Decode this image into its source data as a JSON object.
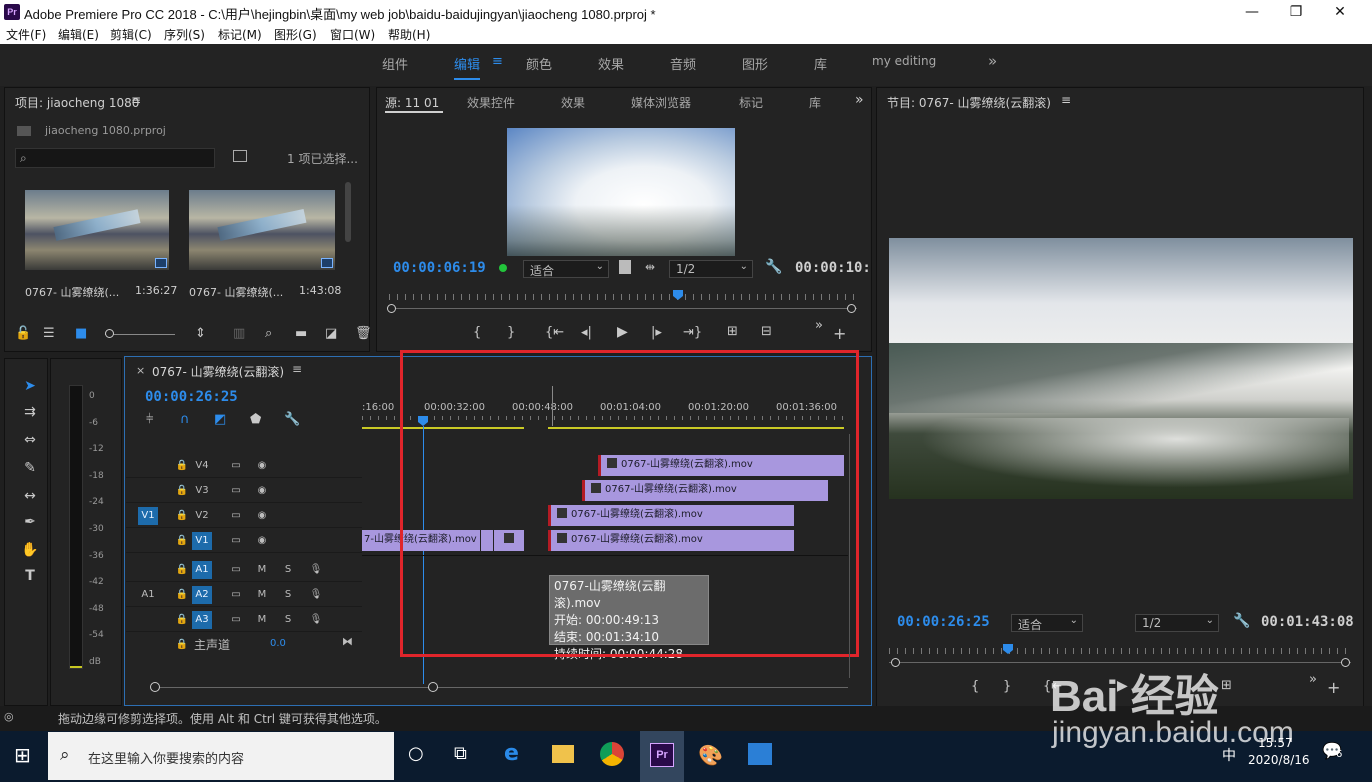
{
  "window": {
    "title": "Adobe Premiere Pro CC 2018 - C:\\用户\\hejingbin\\桌面\\my web job\\baidu-baidujingyan\\jiaocheng 1080.prproj *",
    "logo_text": "Pr",
    "minimize": "—",
    "maximize": "❐",
    "close": "✕"
  },
  "menu": [
    "文件(F)",
    "编辑(E)",
    "剪辑(C)",
    "序列(S)",
    "标记(M)",
    "图形(G)",
    "窗口(W)",
    "帮助(H)"
  ],
  "workspaces": {
    "tabs": [
      "组件",
      "编辑",
      "颜色",
      "效果",
      "音频",
      "图形",
      "库",
      "my editing"
    ],
    "active": "编辑",
    "more": "»"
  },
  "project": {
    "title": "项目: jiaocheng 1080",
    "file": "jiaocheng 1080.prproj",
    "search_placeholder": "",
    "selection": "1 项已选择...",
    "items": [
      {
        "name": "0767- 山雾缭绕(...",
        "duration": "1:36:27"
      },
      {
        "name": "0767- 山雾缭绕(...",
        "duration": "1:43:08"
      }
    ]
  },
  "source": {
    "tabs": [
      "源: 11 01",
      "效果控件",
      "效果",
      "媒体浏览器",
      "标记",
      "库"
    ],
    "timecode": "00:00:06:19",
    "fit": "适合",
    "resolution": "1/2",
    "duration": "00:00:10:"
  },
  "program": {
    "title": "节目: 0767- 山雾缭绕(云翻滚)",
    "timecode": "00:00:26:25",
    "fit": "适合",
    "resolution": "1/2",
    "duration": "00:01:43:08"
  },
  "timeline": {
    "sequence": "0767- 山雾缭绕(云翻滚)",
    "timecode": "00:00:26:25",
    "ruler": [
      ":16:00",
      "00:00:32:00",
      "00:00:48:00",
      "00:01:04:00",
      "00:01:20:00",
      "00:01:36:00"
    ],
    "video_tracks": [
      "V4",
      "V3",
      "V2",
      "V1"
    ],
    "audio_tracks": [
      "A1",
      "A2",
      "A3"
    ],
    "source_v": "V1",
    "source_a": "A1",
    "master": "主声道",
    "master_value": "0.0",
    "clip_name": "0767-山雾缭绕(云翻滚).mov",
    "clip_name_left": "7-山雾缭绕(云翻滚).mov",
    "mute": "M",
    "solo": "S",
    "tooltip": {
      "name": "0767-山雾缭绕(云翻滚).mov",
      "start": "开始: 00:00:49:13",
      "end": "结束: 00:01:34:10",
      "duration": "持续时间: 00:00:44:28"
    }
  },
  "meter": {
    "labels": [
      "0",
      "-6",
      "-12",
      "-18",
      "-24",
      "-30",
      "-36",
      "-42",
      "-48",
      "-54",
      "dB"
    ]
  },
  "status": "拖动边缘可修剪选择项。使用 Alt 和 Ctrl 键可获得其他选项。",
  "taskbar": {
    "search": "在这里输入你要搜索的内容",
    "time": "15:57",
    "date": "2020/8/16",
    "ime": "中",
    "notify": "6"
  },
  "watermark": {
    "line1": "Bai  经验",
    "line2": "jingyan.baidu.com"
  },
  "colors": {
    "accent": "#2d8ceb",
    "clip": "#a897de",
    "highlight_box": "#e0252b",
    "track_tag": "#1d6bab"
  }
}
